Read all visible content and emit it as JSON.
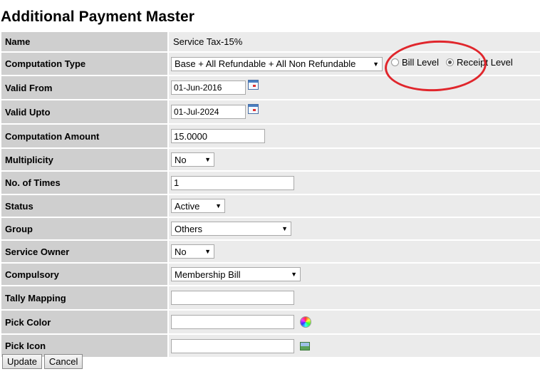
{
  "page": {
    "title": "Additional Payment Master"
  },
  "fields": {
    "name": {
      "label": "Name",
      "value": "Service Tax-15%"
    },
    "computation_type": {
      "label": "Computation Type",
      "value": "Base + All Refundable + All Non Refundable"
    },
    "level": {
      "bill_label": "Bill Level",
      "receipt_label": "Receipt Level",
      "selected": "Receipt Level"
    },
    "valid_from": {
      "label": "Valid From",
      "value": "01-Jun-2016"
    },
    "valid_upto": {
      "label": "Valid Upto",
      "value": "01-Jul-2024"
    },
    "computation_amount": {
      "label": "Computation Amount",
      "value": "15.0000"
    },
    "multiplicity": {
      "label": "Multiplicity",
      "value": "No"
    },
    "no_of_times": {
      "label": "No. of Times",
      "value": "1"
    },
    "status": {
      "label": "Status",
      "value": "Active"
    },
    "group": {
      "label": "Group",
      "value": "Others"
    },
    "service_owner": {
      "label": "Service Owner",
      "value": "No"
    },
    "compulsory": {
      "label": "Compulsory",
      "value": "Membership Bill"
    },
    "tally_mapping": {
      "label": "Tally Mapping",
      "value": ""
    },
    "pick_color": {
      "label": "Pick Color",
      "value": ""
    },
    "pick_icon": {
      "label": "Pick Icon",
      "value": ""
    }
  },
  "icons": {
    "calendar": "calendar-icon",
    "color": "color-wheel-icon",
    "image": "image-icon",
    "dropdown": "chevron-down-icon"
  },
  "annotation": {
    "color": "#e0262c"
  },
  "buttons": {
    "update": "Update",
    "cancel": "Cancel"
  }
}
